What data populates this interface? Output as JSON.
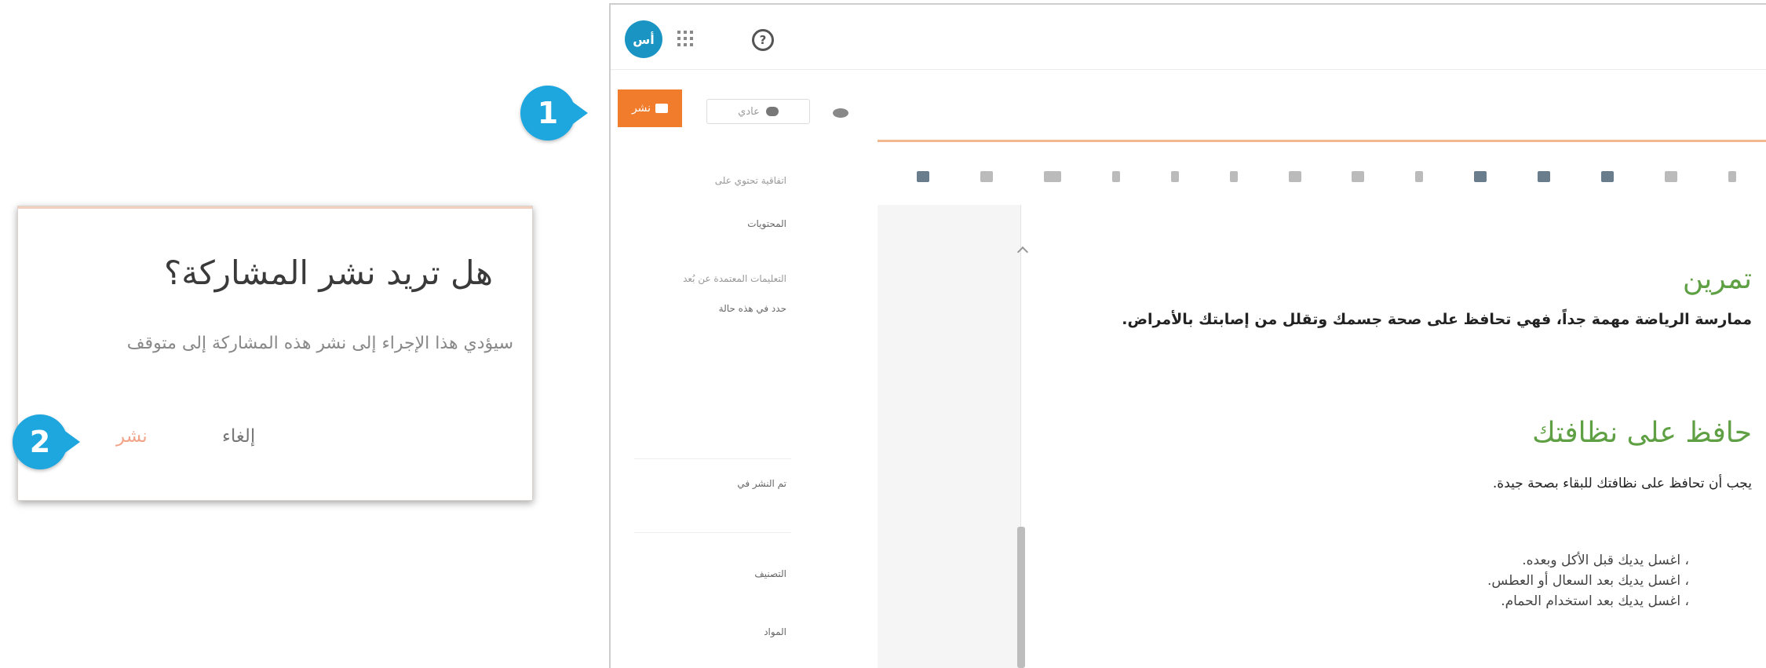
{
  "callouts": [
    "1",
    "2"
  ],
  "dialog": {
    "title": "هل تريد نشر المشاركة؟",
    "message": "سيؤدي هذا الإجراء إلى نشر هذه المشاركة إلى متوقف",
    "cancel_label": "إلغاء",
    "publish_label": "نشر"
  },
  "app": {
    "avatar_initials": "أس",
    "help_symbol": "?",
    "send_label": "نشر",
    "size_label": "عادي",
    "sidebar": {
      "label1": "اتفاقية تحتوي على",
      "value1": "المحتويات",
      "label2": "التعليمات المعتمدة عن بُعد",
      "value2": "حدد في هذه حالة",
      "value3": "تم النشر في",
      "value4": "التصنيف",
      "value5": "المواد"
    },
    "document": {
      "heading1": "تمرين",
      "para1": "ممارسة الرياضة مهمة جداً، فهي تحافظ على صحة جسمك وتقلل من إصابتك بالأمراض.",
      "heading2": "حافظ على نظافتك",
      "para2": "يجب أن تحافظ على نظافتك للبقاء بصحة جيدة.",
      "bullets": [
        "اغسل يديك قبل الأكل وبعده.",
        "اغسل يديك بعد السعال أو العطس.",
        "اغسل يديك بعد استخدام الحمام."
      ]
    }
  }
}
